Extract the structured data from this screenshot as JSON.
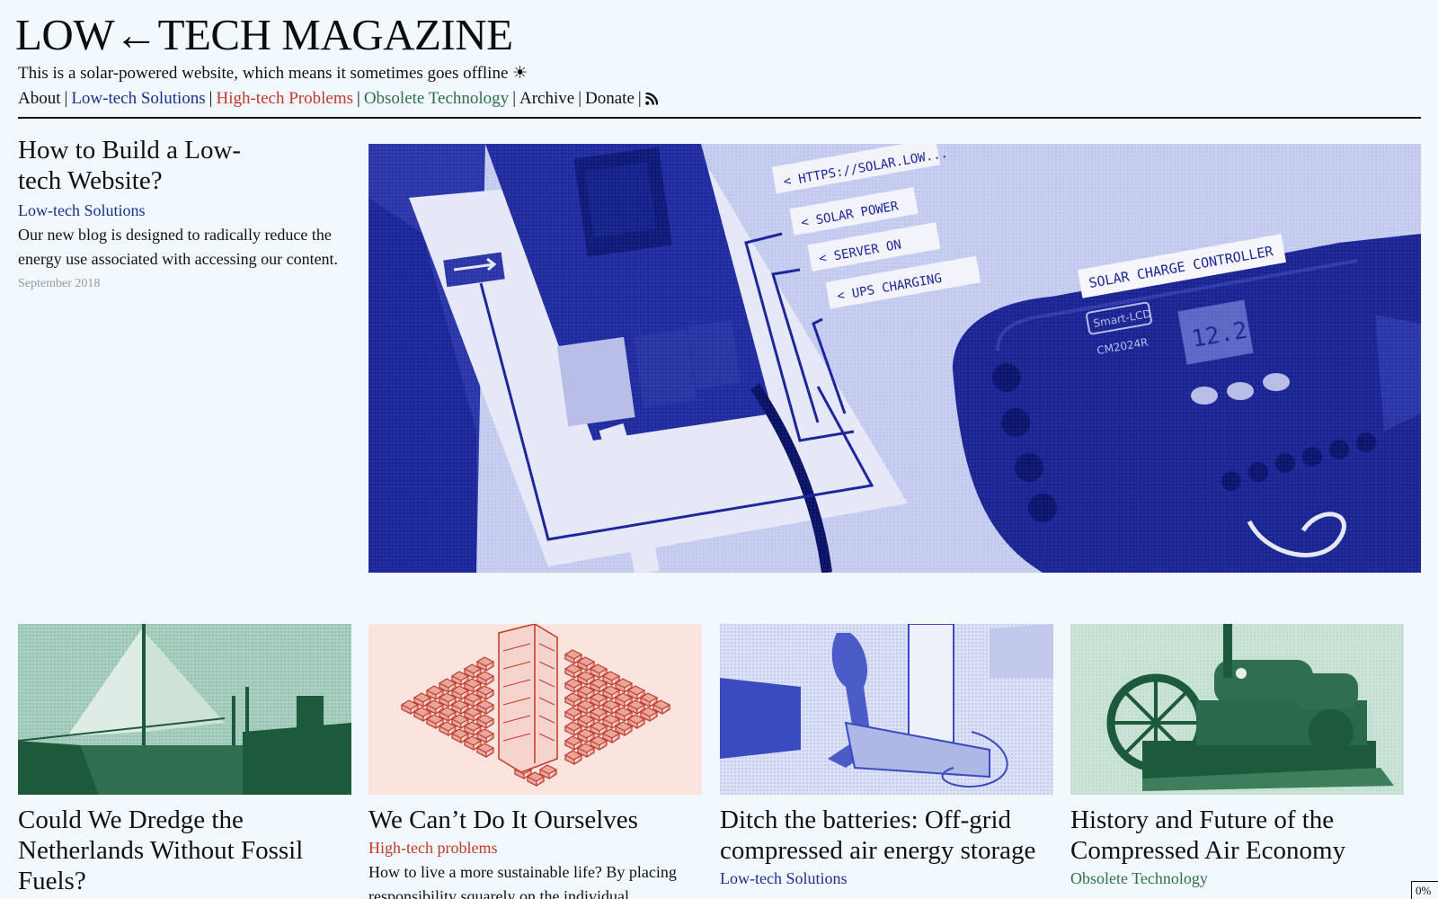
{
  "site": {
    "title": "LOW←TECH MAGAZINE",
    "tagline": "This is a solar-powered website, which means it sometimes goes offline ☀"
  },
  "nav": {
    "about": "About",
    "low_tech": "Low-tech Solutions",
    "high_tech": "High-tech Problems",
    "obsolete": "Obsolete Technology",
    "archive": "Archive",
    "donate": "Donate",
    "sep": "|",
    "rss_icon": "rss-icon"
  },
  "colors": {
    "background": "#f1f8fe",
    "low_tech": "#1a2f8c",
    "high_tech": "#c0392b",
    "obsolete": "#2e6f4a"
  },
  "featured": {
    "title": "How to Build a Low-tech Website?",
    "category": "Low-tech Solutions",
    "description": "Our new blog is designed to radically reduce the energy use associated with accessing our content.",
    "date": "September 2018",
    "image_labels": {
      "l1": "< HTTPS://SOLAR.LOW...",
      "l2": "< SOLAR POWER",
      "l3": "< SERVER ON",
      "l4": "< UPS CHARGING",
      "controller": "SOLAR CHARGE CONTROLLER",
      "brand": "Smart-LCD",
      "model": "CM2024R",
      "lcd": "12.2"
    }
  },
  "cards": [
    {
      "title": "Could We Dredge the Netherlands Without Fossil Fuels?",
      "category": "",
      "description": ""
    },
    {
      "title": "We Can’t Do It Ourselves",
      "category": "High-tech problems",
      "description": "How to live a more sustainable life? By placing responsibility squarely on the individual..."
    },
    {
      "title": "Ditch the batteries: Off-grid compressed air energy storage",
      "category": "Low-tech Solutions",
      "description": ""
    },
    {
      "title": "History and Future of the Compressed Air Economy",
      "category": "Obsolete Technology",
      "description": ""
    }
  ],
  "progress": "0%"
}
